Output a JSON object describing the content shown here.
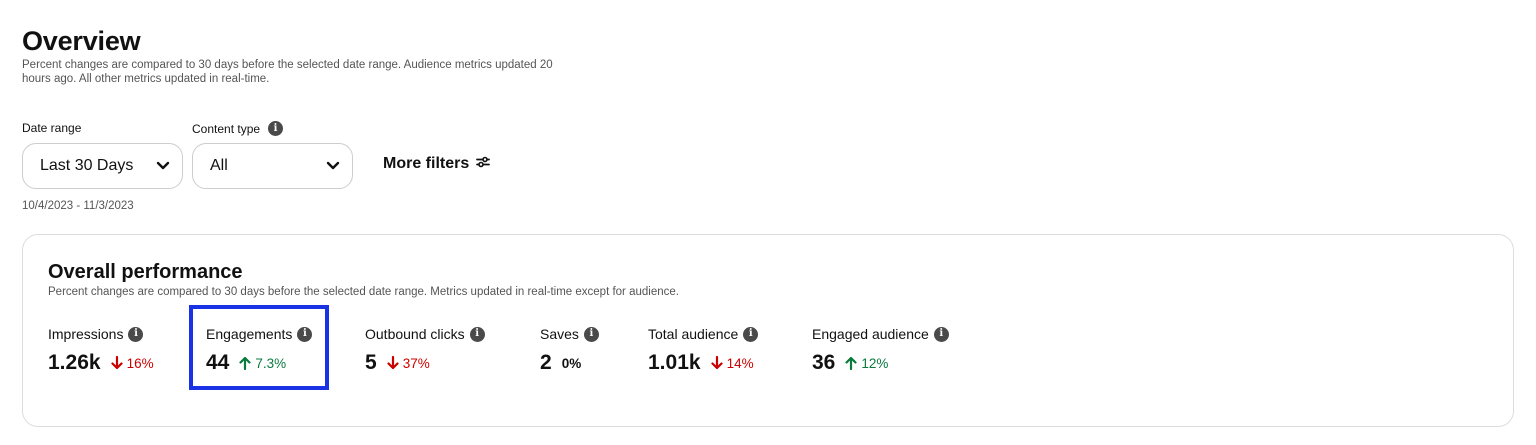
{
  "overview": {
    "title": "Overview",
    "subtitle": "Percent changes are compared to 30 days before the selected date range. Audience metrics updated 20 hours ago. All other metrics updated in real-time."
  },
  "filters": {
    "date_range_label": "Date range",
    "date_range_value": "Last 30 Days",
    "content_type_label": "Content type",
    "content_type_value": "All",
    "more_filters_label": "More filters",
    "date_text": "10/4/2023 - 11/3/2023"
  },
  "performance": {
    "title": "Overall performance",
    "subtitle": "Percent changes are compared to 30 days before the selected date range. Metrics updated in real-time except for audience.",
    "metrics": [
      {
        "label": "Impressions",
        "value": "1.26k",
        "change": "16%",
        "direction": "down"
      },
      {
        "label": "Engagements",
        "value": "44",
        "change": "7.3%",
        "direction": "up"
      },
      {
        "label": "Outbound clicks",
        "value": "5",
        "change": "37%",
        "direction": "down"
      },
      {
        "label": "Saves",
        "value": "2",
        "change": "0%",
        "direction": "flat"
      },
      {
        "label": "Total audience",
        "value": "1.01k",
        "change": "14%",
        "direction": "down"
      },
      {
        "label": "Engaged audience",
        "value": "36",
        "change": "12%",
        "direction": "up"
      }
    ]
  },
  "info_icon_glyph": "i",
  "colors": {
    "down": "#cc0000",
    "up": "#0a7a3f",
    "highlight": "#1a32e6"
  }
}
